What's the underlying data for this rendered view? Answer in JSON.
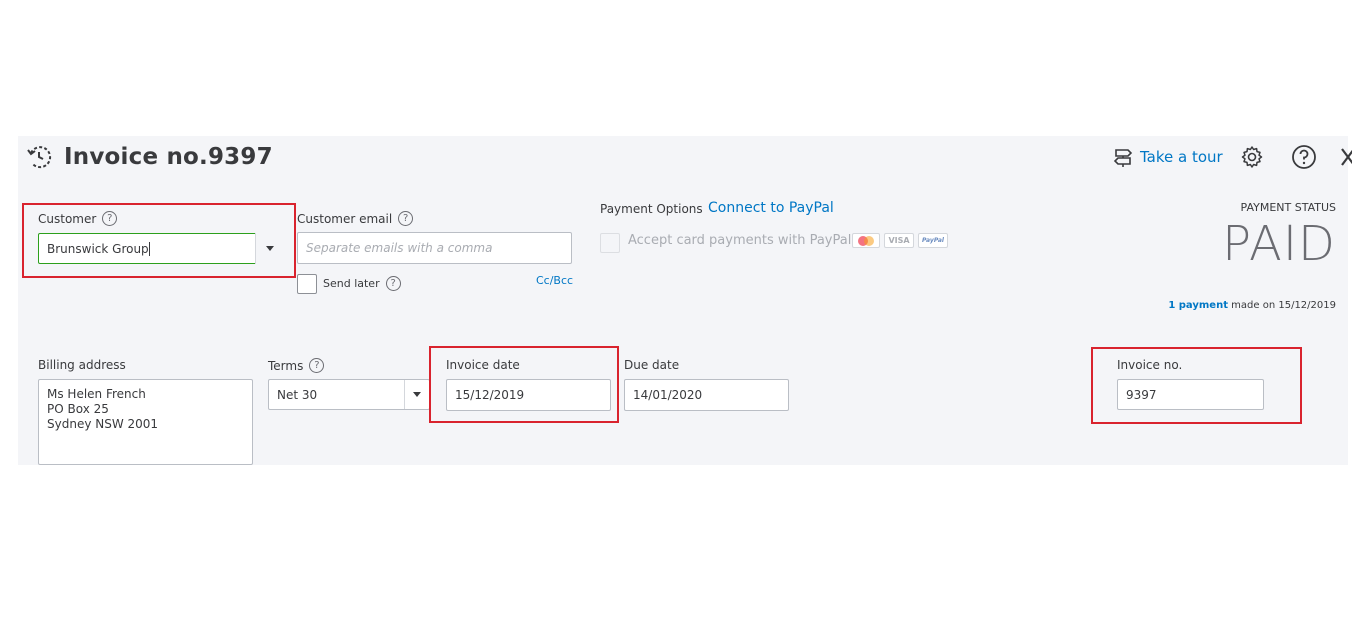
{
  "header": {
    "title": "Invoice no.9397",
    "take_tour": "Take a tour"
  },
  "customer": {
    "label": "Customer",
    "value": "Brunswick Group"
  },
  "customer_email": {
    "label": "Customer email",
    "placeholder": "Separate emails with a comma",
    "send_later": "Send later",
    "cc_bcc": "Cc/Bcc"
  },
  "payment_options": {
    "label": "Payment Options",
    "connect": "Connect to PayPal",
    "accept": "Accept card payments with PayPal",
    "cards": [
      "VISA",
      "PayPal"
    ]
  },
  "payment_status": {
    "label": "PAYMENT STATUS",
    "status": "PAID",
    "payment_link": "1 payment",
    "payment_text": "made on 15/12/2019"
  },
  "billing": {
    "label": "Billing address",
    "lines": [
      "Ms Helen French",
      "PO Box 25",
      "Sydney NSW  2001"
    ]
  },
  "terms": {
    "label": "Terms",
    "value": "Net 30"
  },
  "invoice_date": {
    "label": "Invoice date",
    "value": "15/12/2019"
  },
  "due_date": {
    "label": "Due date",
    "value": "14/01/2020"
  },
  "invoice_no": {
    "label": "Invoice no.",
    "value": "9397"
  },
  "colors": {
    "accent_link": "#0077c5",
    "focus_green": "#2ca01c",
    "highlight_red": "#d9232e",
    "panel_bg": "#f4f5f8"
  }
}
